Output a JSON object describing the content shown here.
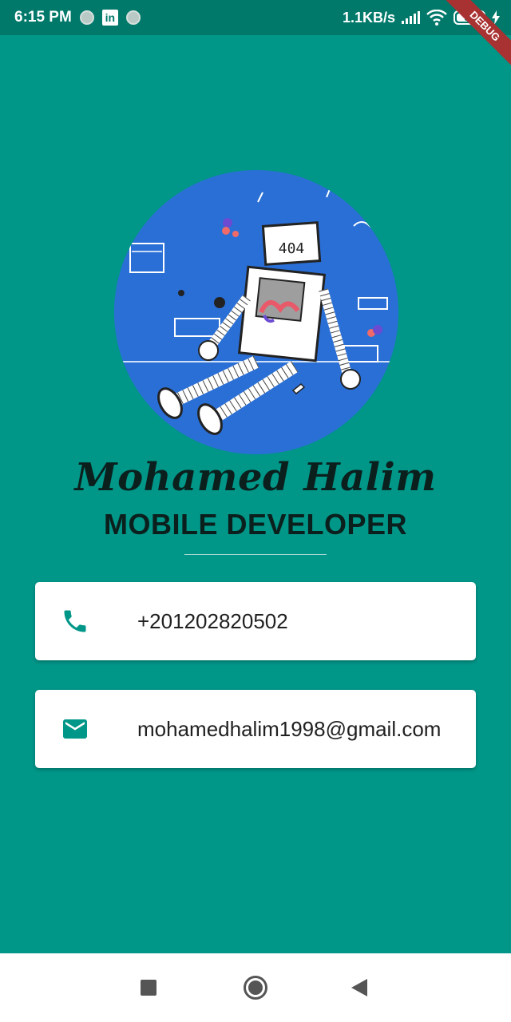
{
  "status_bar": {
    "time": "6:15 PM",
    "linkedin_icon_text": "in",
    "network_speed": "1.1KB/s",
    "battery_level": "56",
    "icons": [
      "notification-dot-icon",
      "linkedin-icon",
      "signal-icon",
      "wifi-icon",
      "battery-icon",
      "charging-icon"
    ]
  },
  "debug_banner": "DEBUG",
  "profile": {
    "avatar_text": "404",
    "name": "Mohamed Halim",
    "title": "MOBILE DEVELOPER"
  },
  "contacts": {
    "phone": {
      "icon": "phone-icon",
      "value": "+201202820502"
    },
    "email": {
      "icon": "email-icon",
      "value": "mohamedhalim1998@gmail.com"
    }
  },
  "nav_bar": {
    "icons": [
      "recents-icon",
      "home-icon",
      "back-icon"
    ]
  },
  "colors": {
    "background": "#009688",
    "status_bar": "#00796b",
    "avatar_bg": "#2a6fd6",
    "icon_accent": "#009688",
    "text_dark": "#0b1f1d"
  }
}
